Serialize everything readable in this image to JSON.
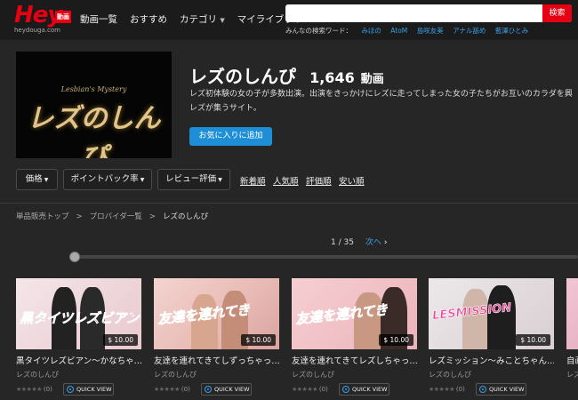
{
  "header": {
    "logo_text": "Hey",
    "logo_badge": "動画",
    "logo_domain": "heydouga.com",
    "nav": [
      {
        "label": "動画一覧"
      },
      {
        "label": "おすすめ"
      },
      {
        "label": "カテゴリ",
        "caret": "▼"
      },
      {
        "label": "マイライブラリ"
      }
    ],
    "search": {
      "placeholder": "",
      "button_label": "検索"
    },
    "popular_label": "みんなの検索ワード：",
    "popular_keywords": [
      "みほの",
      "AtoM",
      "島咲友美",
      "アナル舐め",
      "藍澤ひとみ"
    ]
  },
  "provider": {
    "image_subtitle": "Lesbian's Mystery",
    "image_logo_text": "レズのしんぴ",
    "title": "レズのしんぴ",
    "count": "1,646",
    "count_unit": "動画",
    "description_line1": "レズ初体験の女の子が多数出演。出演をきっかけにレズに走ってしまった女の子たちがお互いのカラダを興",
    "description_line2": "レズが集うサイト。",
    "favorite_button": "お気に入りに追加"
  },
  "filters": {
    "dropdowns": [
      {
        "label": "価格"
      },
      {
        "label": "ポイントバック率"
      },
      {
        "label": "レビュー評価"
      }
    ],
    "sort_links": [
      "新着順",
      "人気順",
      "評価順",
      "安い順"
    ]
  },
  "breadcrumb": [
    "単品販売トップ",
    "プロバイダ一覧",
    "レズのしんぴ"
  ],
  "breadcrumb_sep": ">",
  "pager": {
    "page": "1",
    "sep": "/",
    "total": "35",
    "next_label": "次へ",
    "next_icon": "chevron-right-icon"
  },
  "slider": {
    "position_fraction": 0.0
  },
  "cards": [
    {
      "overlay": "黒タイツレズビアン",
      "title": "黒タイツレズビアン～かなちゃ…",
      "provider": "レズのしんぴ",
      "price": "$ 10.00",
      "rating_count": "(0)",
      "quick_view": "QUICK VIEW"
    },
    {
      "overlay": "友達を連れてき",
      "title": "友達を連れてきてしずっちゃっ…",
      "provider": "レズのしんぴ",
      "price": "$ 10.00",
      "rating_count": "(0)",
      "quick_view": "QUICK VIEW"
    },
    {
      "overlay": "友達を連れてき",
      "title": "友達を連れてきてレズしちゃっ…",
      "provider": "レズのしんぴ",
      "price": "$ 10.00",
      "rating_count": "(0)",
      "quick_view": "QUICK VIEW"
    },
    {
      "overlay": "LESMISSION",
      "title": "レズミッション～みことちゃん…",
      "provider": "レズのしんぴ",
      "price": "$ 10.00",
      "rating_count": "(0)",
      "quick_view": "QUICK VIEW"
    },
    {
      "overlay": "",
      "title": "自画撮",
      "provider": "レズの",
      "price": "",
      "rating_count": "",
      "quick_view": ""
    }
  ],
  "stars_glyph": "★★★★★",
  "colors": {
    "accent_red": "#e60012",
    "accent_blue": "#1e8fd6",
    "link_blue": "#3aa0e8",
    "background": "#262626"
  }
}
